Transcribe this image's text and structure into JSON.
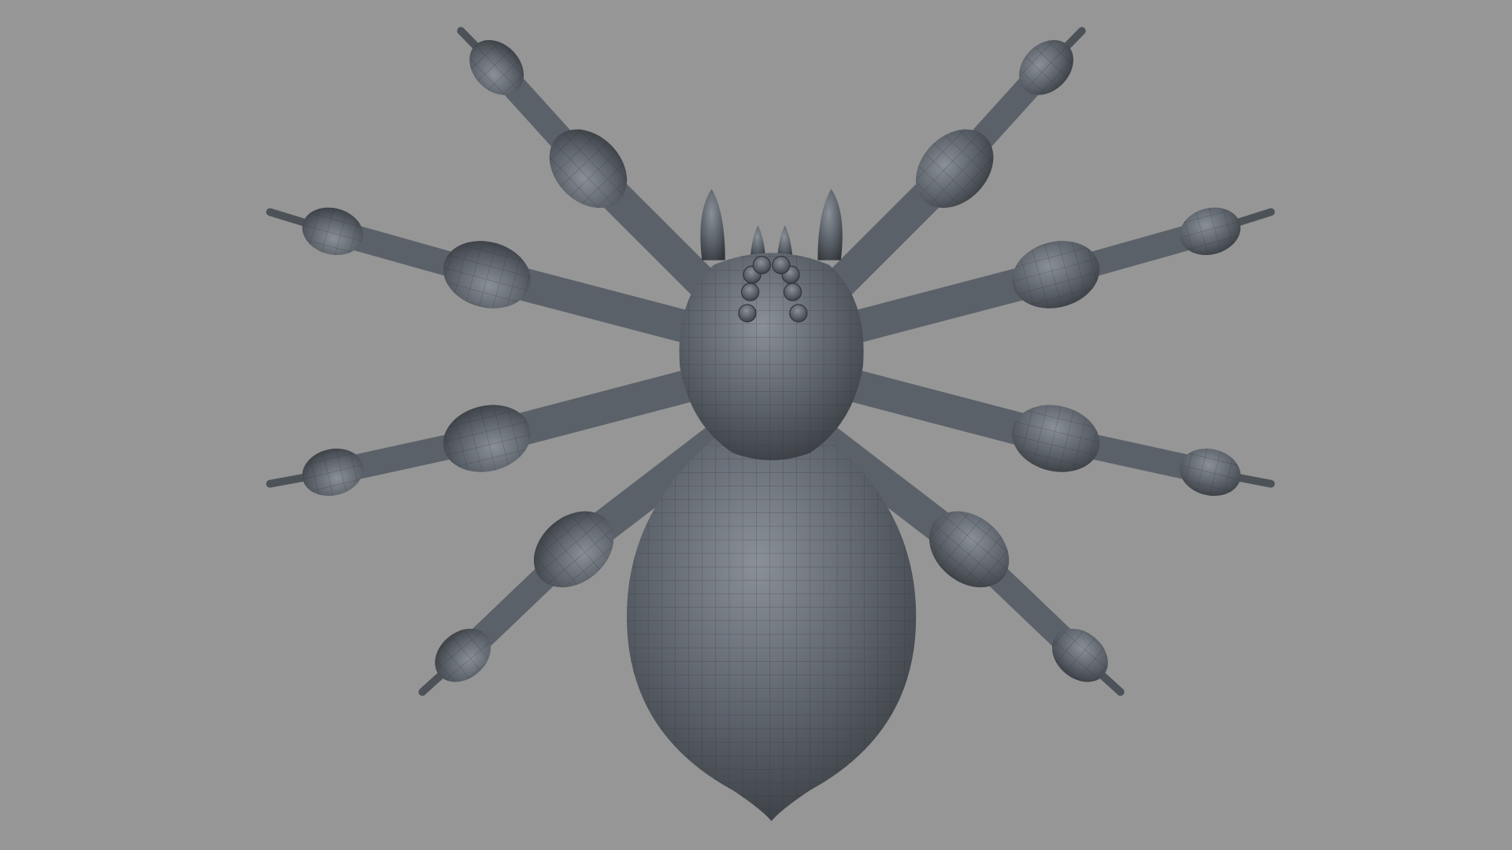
{
  "scene": {
    "background_color": "#969696",
    "model_color": "#5b6169",
    "model_highlight_color": "#8a9098",
    "model_shadow_color": "#33373c",
    "wireframe_color": "#2a2d31",
    "subject": "spider-model-wireframe"
  }
}
